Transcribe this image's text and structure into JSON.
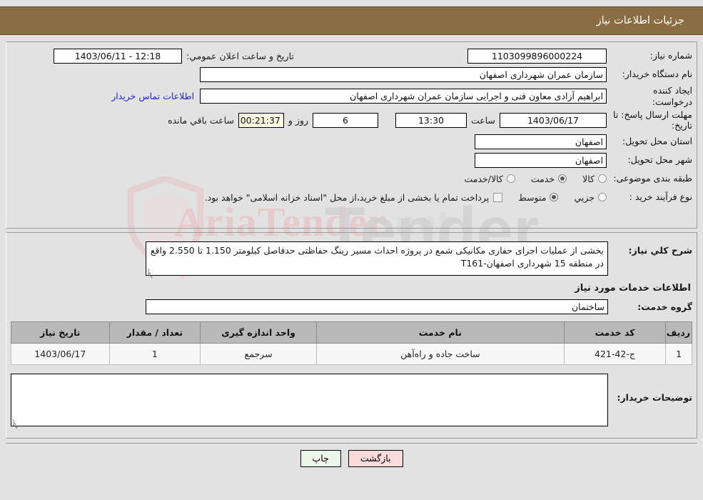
{
  "header": {
    "title": "جزئیات اطلاعات نیاز"
  },
  "form": {
    "need_number_label": "شماره نیاز:",
    "need_number_value": "1103099896000224",
    "public_announce_label": "تاریخ و ساعت اعلان عمومي:",
    "public_announce_value": "12:18 - 1403/06/11",
    "buyer_org_label": "نام دستگاه خریدار:",
    "buyer_org_value": "سازمان عمران شهرداری اصفهان",
    "requester_label": "ایجاد کننده درخواست:",
    "requester_value": "ابراهیم آزادی معاون فنی و اجرایی سازمان عمران شهرداری اصفهان",
    "contact_link": "اطلاعات تماس خریدار",
    "deadline_label": "مهلت ارسال پاسخ: تا تاریخ:",
    "deadline_date": "1403/06/17",
    "deadline_time_label": "ساعت",
    "deadline_time": "13:30",
    "days_remaining": "6",
    "days_label": "روز و",
    "timer_value": "00:21:37",
    "timer_label": "ساعت باقي مانده",
    "province_label": "استان محل تحویل:",
    "province_value": "اصفهان",
    "city_label": "شهر محل تحویل:",
    "city_value": "اصفهان",
    "category_label": "طبقه بندی موضوعی:",
    "category_options": [
      {
        "label": "کالا",
        "selected": false
      },
      {
        "label": "خدمت",
        "selected": true
      },
      {
        "label": "کالا/خدمت",
        "selected": false
      }
    ],
    "process_label": "نوع فرآیند خرید :",
    "process_options": [
      {
        "label": "جزیي",
        "selected": false
      },
      {
        "label": "متوسط",
        "selected": true
      }
    ],
    "payment_checkbox_checked": false,
    "payment_note": "پرداخت تمام یا بخشی از مبلغ خرید،از محل \"اسناد خزانه اسلامی\" خواهد بود."
  },
  "description": {
    "label": "شرح كلي نياز:",
    "text": "بخشی از عملیات اجرای حفاری مکانیکی شمع  در پروژه احداث مسیر رینگ حفاظتی حدفاصل کیلومتر 1.150 تا 2.550 واقع در منطقه 15 شهرداری اصفهان-T161"
  },
  "services": {
    "section_title": "اطلاعات خدمات مورد نیاز",
    "group_label": "گروه خدمت:",
    "group_value": "ساختمان",
    "columns": [
      "ردیف",
      "کد خدمت",
      "نام خدمت",
      "واحد اندازه گیری",
      "تعداد / مقدار",
      "تاریخ نیاز"
    ],
    "rows": [
      {
        "index": "1",
        "code": "ج-42-421",
        "name": "ساخت جاده و راه‌آهن",
        "unit": "سرجمع",
        "quantity": "1",
        "date": "1403/06/17"
      }
    ]
  },
  "comments": {
    "label": "توضیحات خریدار:",
    "value": ""
  },
  "footer": {
    "print_label": "چاپ",
    "back_label": "بازگشت"
  },
  "watermark": {
    "brand_text": "AriaTender",
    "brand_suffix": ".net",
    "grey_text": "Tender"
  },
  "colors": {
    "header_bg": "#8a6d42",
    "page_bg": "#e2e2e2",
    "link": "#2424cc",
    "table_header": "#b9b9b9",
    "back_button": "#fadadd",
    "print_button": "#eaf7ea",
    "timer_bg": "#fbfbe4"
  }
}
